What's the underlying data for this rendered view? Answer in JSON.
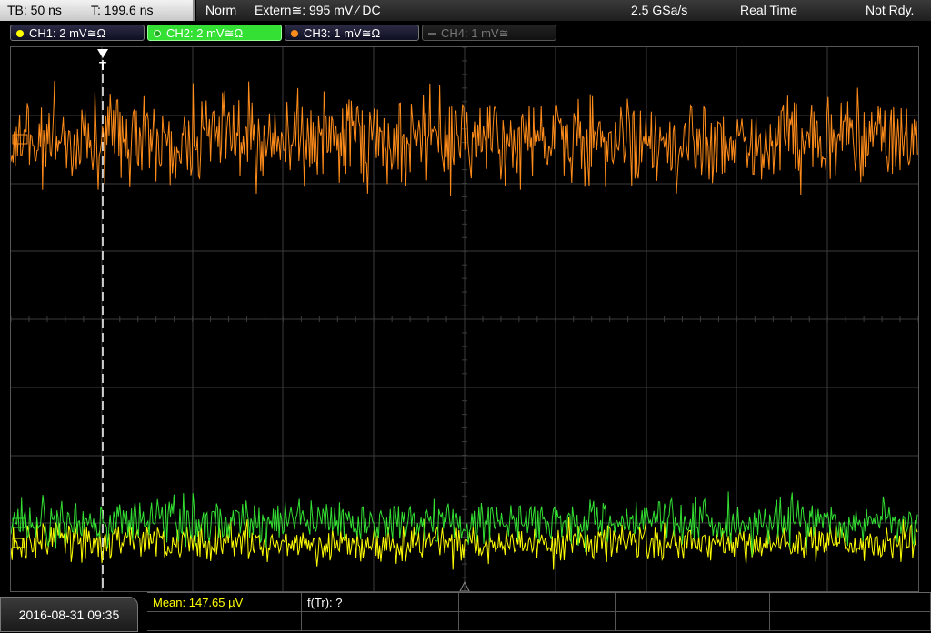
{
  "status_bar": {
    "timebase": "TB: 50 ns",
    "trigger_time": "T: 199.6 ns",
    "trigger_mode": "Norm",
    "trigger_source": "Extern≅: 995 mV ⁄ DC",
    "sample_rate": "2.5 GSa/s",
    "acq_mode": "Real Time",
    "ready_state": "Not Rdy."
  },
  "channels": [
    {
      "label": "CH1: 2 mV≅Ω",
      "color": "#ffff00",
      "active": false
    },
    {
      "label": "CH2: 2 mV≅Ω",
      "color": "#33e033",
      "active": true
    },
    {
      "label": "CH3: 1 mV≅Ω",
      "color": "#ff8c1a",
      "active": false
    },
    {
      "label": "CH4: 1 mV≅",
      "color": "#777777",
      "active": false
    }
  ],
  "trigger_marker_label": "T",
  "colors": {
    "ch1_trace": "#ffff00",
    "ch2_trace": "#33e033",
    "ch3_trace": "#ff8c1a",
    "grid": "#3c3c3c",
    "trigger_line": "#ffffff"
  },
  "measurements": {
    "mean": "Mean: 147.65 µV",
    "f_tr": "f(Tr): ?"
  },
  "datetime": "2016-08-31 09:35"
}
